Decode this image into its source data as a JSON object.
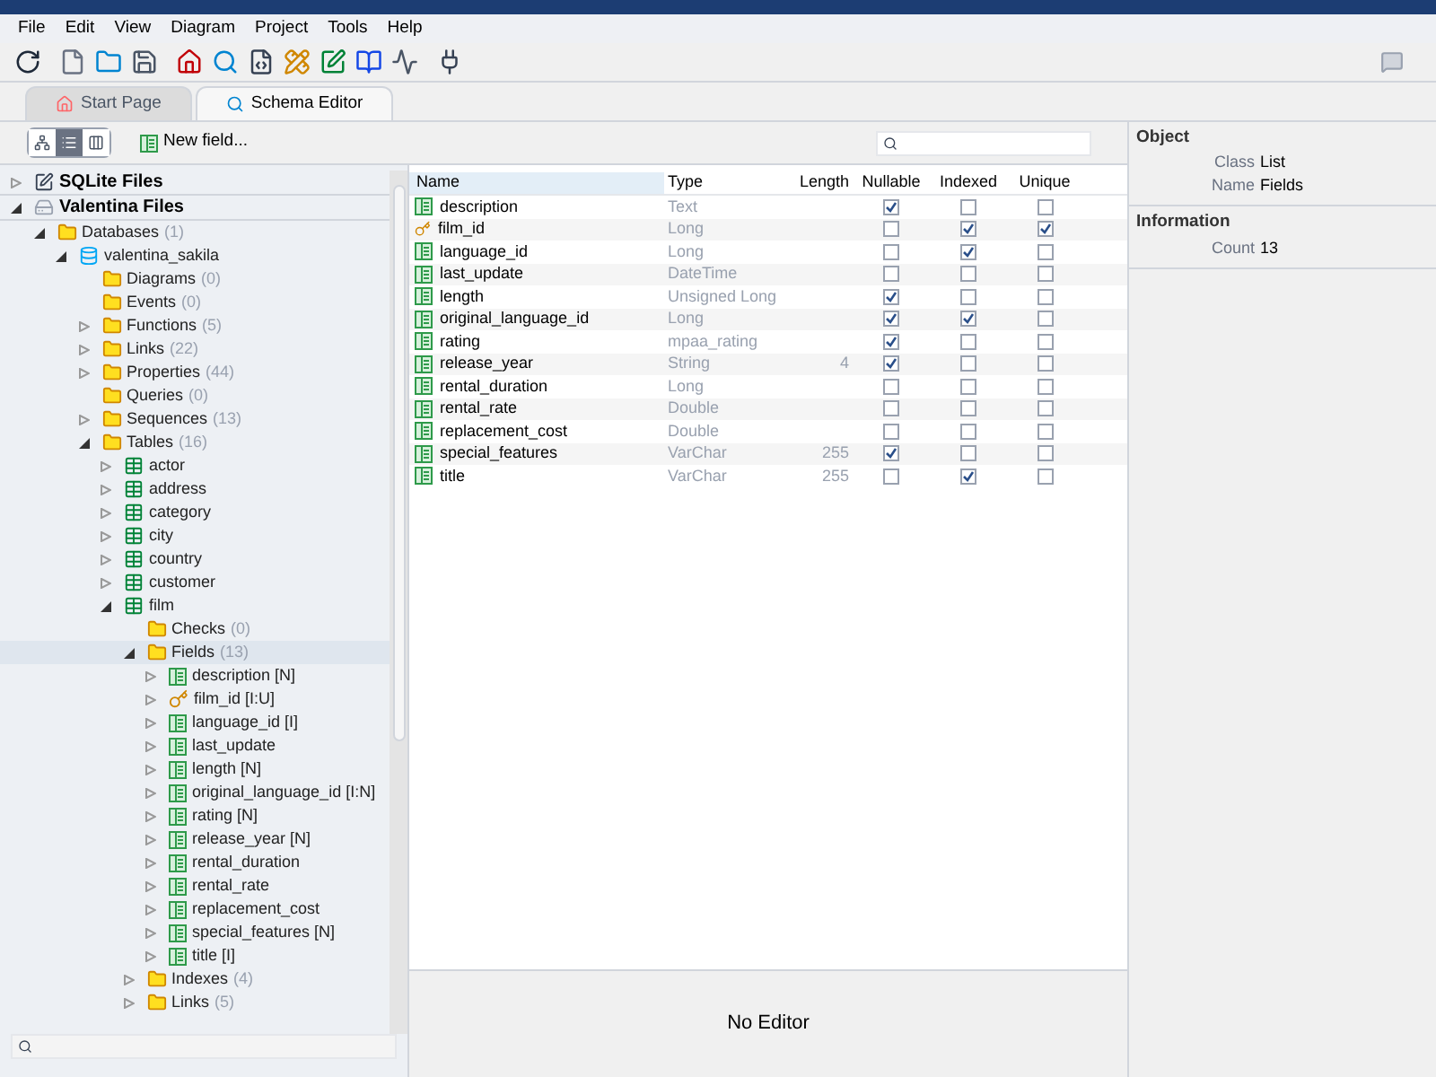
{
  "menu": [
    "File",
    "Edit",
    "View",
    "Diagram",
    "Project",
    "Tools",
    "Help"
  ],
  "tabs": [
    {
      "label": "Start Page",
      "selected": false
    },
    {
      "label": "Schema Editor",
      "selected": true
    }
  ],
  "view_modes": [
    {
      "selected": false
    },
    {
      "selected": true
    },
    {
      "selected": false
    }
  ],
  "new_field": "New field...",
  "tree": [
    {
      "label": "SQLite Files",
      "kind": "sqlite",
      "expandable": true,
      "expanded": false,
      "selected": false
    },
    {
      "label": "Valentina Files",
      "kind": "valentina",
      "expandable": true,
      "expanded": true,
      "selected": false,
      "children": [
        {
          "label": "Databases",
          "count": "(1)",
          "kind": "folder",
          "expandable": true,
          "expanded": true,
          "selected": false,
          "children": [
            {
              "label": "valentina_sakila",
              "kind": "db",
              "expandable": true,
              "expanded": true,
              "selected": false,
              "children": [
                {
                  "label": "Diagrams",
                  "count": "(0)",
                  "kind": "folder",
                  "expandable": false,
                  "expanded": false,
                  "selected": false
                },
                {
                  "label": "Events",
                  "count": "(0)",
                  "kind": "folder",
                  "expandable": false,
                  "expanded": false,
                  "selected": false
                },
                {
                  "label": "Functions",
                  "count": "(5)",
                  "kind": "folder",
                  "expandable": true,
                  "expanded": false,
                  "selected": false
                },
                {
                  "label": "Links",
                  "count": "(22)",
                  "kind": "folder",
                  "expandable": true,
                  "expanded": false,
                  "selected": false
                },
                {
                  "label": "Properties",
                  "count": "(44)",
                  "kind": "folder",
                  "expandable": true,
                  "expanded": false,
                  "selected": false
                },
                {
                  "label": "Queries",
                  "count": "(0)",
                  "kind": "folder",
                  "expandable": false,
                  "expanded": false,
                  "selected": false
                },
                {
                  "label": "Sequences",
                  "count": "(13)",
                  "kind": "folder",
                  "expandable": true,
                  "expanded": false,
                  "selected": false
                },
                {
                  "label": "Tables",
                  "count": "(16)",
                  "kind": "folder",
                  "expandable": true,
                  "expanded": true,
                  "selected": false,
                  "children": [
                    {
                      "label": "actor",
                      "kind": "table",
                      "expandable": true,
                      "expanded": false,
                      "selected": false
                    },
                    {
                      "label": "address",
                      "kind": "table",
                      "expandable": true,
                      "expanded": false,
                      "selected": false
                    },
                    {
                      "label": "category",
                      "kind": "table",
                      "expandable": true,
                      "expanded": false,
                      "selected": false
                    },
                    {
                      "label": "city",
                      "kind": "table",
                      "expandable": true,
                      "expanded": false,
                      "selected": false
                    },
                    {
                      "label": "country",
                      "kind": "table",
                      "expandable": true,
                      "expanded": false,
                      "selected": false
                    },
                    {
                      "label": "customer",
                      "kind": "table",
                      "expandable": true,
                      "expanded": false,
                      "selected": false
                    },
                    {
                      "label": "film",
                      "kind": "table",
                      "expandable": true,
                      "expanded": true,
                      "selected": false,
                      "children": [
                        {
                          "label": "Checks",
                          "count": "(0)",
                          "kind": "folder",
                          "expandable": false,
                          "expanded": false,
                          "selected": false
                        },
                        {
                          "label": "Fields",
                          "count": "(13)",
                          "kind": "folder",
                          "expandable": true,
                          "expanded": true,
                          "selected": true,
                          "children": [
                            {
                              "label": "description [N]",
                              "kind": "field",
                              "expandable": true,
                              "expanded": false,
                              "selected": false
                            },
                            {
                              "label": "film_id [I:U]",
                              "kind": "key",
                              "expandable": true,
                              "expanded": false,
                              "selected": false
                            },
                            {
                              "label": "language_id [I]",
                              "kind": "field",
                              "expandable": true,
                              "expanded": false,
                              "selected": false
                            },
                            {
                              "label": "last_update",
                              "kind": "field",
                              "expandable": true,
                              "expanded": false,
                              "selected": false
                            },
                            {
                              "label": "length [N]",
                              "kind": "field",
                              "expandable": true,
                              "expanded": false,
                              "selected": false
                            },
                            {
                              "label": "original_language_id [I:N]",
                              "kind": "field",
                              "expandable": true,
                              "expanded": false,
                              "selected": false
                            },
                            {
                              "label": "rating [N]",
                              "kind": "field",
                              "expandable": true,
                              "expanded": false,
                              "selected": false
                            },
                            {
                              "label": "release_year [N]",
                              "kind": "field",
                              "expandable": true,
                              "expanded": false,
                              "selected": false
                            },
                            {
                              "label": "rental_duration",
                              "kind": "field",
                              "expandable": true,
                              "expanded": false,
                              "selected": false
                            },
                            {
                              "label": "rental_rate",
                              "kind": "field",
                              "expandable": true,
                              "expanded": false,
                              "selected": false
                            },
                            {
                              "label": "replacement_cost",
                              "kind": "field",
                              "expandable": true,
                              "expanded": false,
                              "selected": false
                            },
                            {
                              "label": "special_features [N]",
                              "kind": "field",
                              "expandable": true,
                              "expanded": false,
                              "selected": false
                            },
                            {
                              "label": "title [I]",
                              "kind": "field",
                              "expandable": true,
                              "expanded": false,
                              "selected": false
                            }
                          ]
                        },
                        {
                          "label": "Indexes",
                          "count": "(4)",
                          "kind": "folder",
                          "expandable": true,
                          "expanded": false,
                          "selected": false
                        },
                        {
                          "label": "Links",
                          "count": "(5)",
                          "kind": "folder",
                          "expandable": true,
                          "expanded": false,
                          "selected": false
                        }
                      ]
                    }
                  ]
                }
              ]
            }
          ]
        }
      ]
    }
  ],
  "table": {
    "columns": [
      "Name",
      "Type",
      "Length",
      "Nullable",
      "Indexed",
      "Unique"
    ],
    "rows": [
      {
        "name": "description",
        "kind": "field",
        "type": "Text",
        "nullable": true,
        "indexed": false,
        "unique": false
      },
      {
        "name": "film_id",
        "kind": "key",
        "type": "Long",
        "nullable": false,
        "indexed": true,
        "unique": true
      },
      {
        "name": "language_id",
        "kind": "field",
        "type": "Long",
        "nullable": false,
        "indexed": true,
        "unique": false
      },
      {
        "name": "last_update",
        "kind": "field",
        "type": "DateTime",
        "nullable": false,
        "indexed": false,
        "unique": false
      },
      {
        "name": "length",
        "kind": "field",
        "type": "Unsigned Long",
        "nullable": true,
        "indexed": false,
        "unique": false
      },
      {
        "name": "original_language_id",
        "kind": "field",
        "type": "Long",
        "nullable": true,
        "indexed": true,
        "unique": false
      },
      {
        "name": "rating",
        "kind": "field",
        "type": "mpaa_rating",
        "nullable": true,
        "indexed": false,
        "unique": false
      },
      {
        "name": "release_year",
        "kind": "field",
        "type": "String",
        "length": "4",
        "nullable": true,
        "indexed": false,
        "unique": false
      },
      {
        "name": "rental_duration",
        "kind": "field",
        "type": "Long",
        "nullable": false,
        "indexed": false,
        "unique": false
      },
      {
        "name": "rental_rate",
        "kind": "field",
        "type": "Double",
        "nullable": false,
        "indexed": false,
        "unique": false
      },
      {
        "name": "replacement_cost",
        "kind": "field",
        "type": "Double",
        "nullable": false,
        "indexed": false,
        "unique": false
      },
      {
        "name": "special_features",
        "kind": "field",
        "type": "VarChar",
        "length": "255",
        "nullable": true,
        "indexed": false,
        "unique": false
      },
      {
        "name": "title",
        "kind": "field",
        "type": "VarChar",
        "length": "255",
        "nullable": false,
        "indexed": true,
        "unique": false
      }
    ]
  },
  "no_editor": "No Editor",
  "properties": [
    {
      "title": "Object",
      "rows": [
        {
          "key": "Class",
          "value": "List"
        },
        {
          "key": "Name",
          "value": "Fields"
        }
      ]
    },
    {
      "title": "Information",
      "rows": [
        {
          "key": "Count",
          "value": "13"
        }
      ]
    }
  ]
}
